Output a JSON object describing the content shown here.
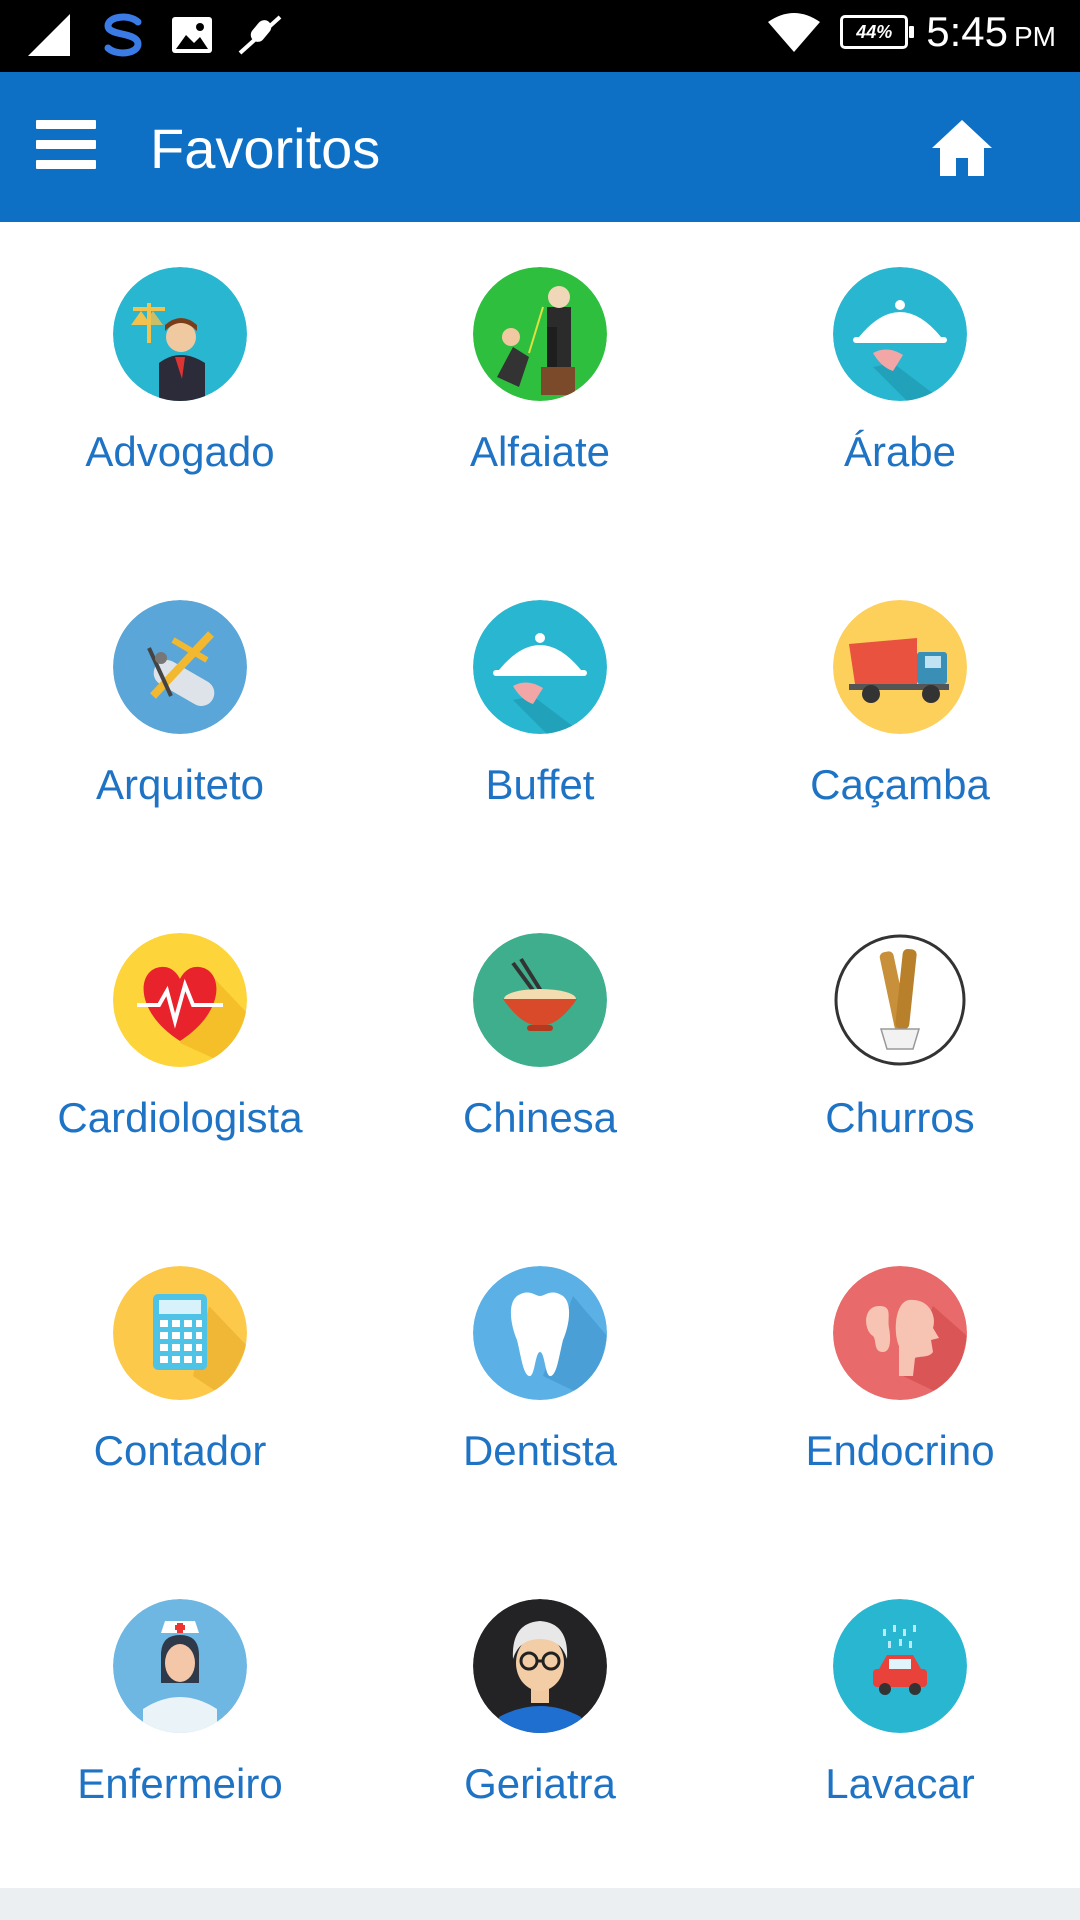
{
  "status_bar": {
    "time": "5:45",
    "ampm": "PM",
    "battery": "44%"
  },
  "app_bar": {
    "title": "Favoritos",
    "menu_icon": "hamburger-menu-icon",
    "home_icon": "home-icon"
  },
  "colors": {
    "primary": "#0d70c5",
    "label": "#1f73c5"
  },
  "categories": [
    {
      "label": "Advogado",
      "icon": "lawyer-icon"
    },
    {
      "label": "Alfaiate",
      "icon": "tailor-icon"
    },
    {
      "label": "Árabe",
      "icon": "cloche-icon"
    },
    {
      "label": "Arquiteto",
      "icon": "architect-icon"
    },
    {
      "label": "Buffet",
      "icon": "cloche-icon"
    },
    {
      "label": "Caçamba",
      "icon": "truck-icon"
    },
    {
      "label": "Cardiologista",
      "icon": "heart-icon"
    },
    {
      "label": "Chinesa",
      "icon": "noodle-bowl-icon"
    },
    {
      "label": "Churros",
      "icon": "churros-icon"
    },
    {
      "label": "Contador",
      "icon": "calculator-icon"
    },
    {
      "label": "Dentista",
      "icon": "tooth-icon"
    },
    {
      "label": "Endocrino",
      "icon": "ent-icon"
    },
    {
      "label": "Enfermeiro",
      "icon": "nurse-icon"
    },
    {
      "label": "Geriatra",
      "icon": "elderly-icon"
    },
    {
      "label": "Lavacar",
      "icon": "car-wash-icon"
    }
  ]
}
